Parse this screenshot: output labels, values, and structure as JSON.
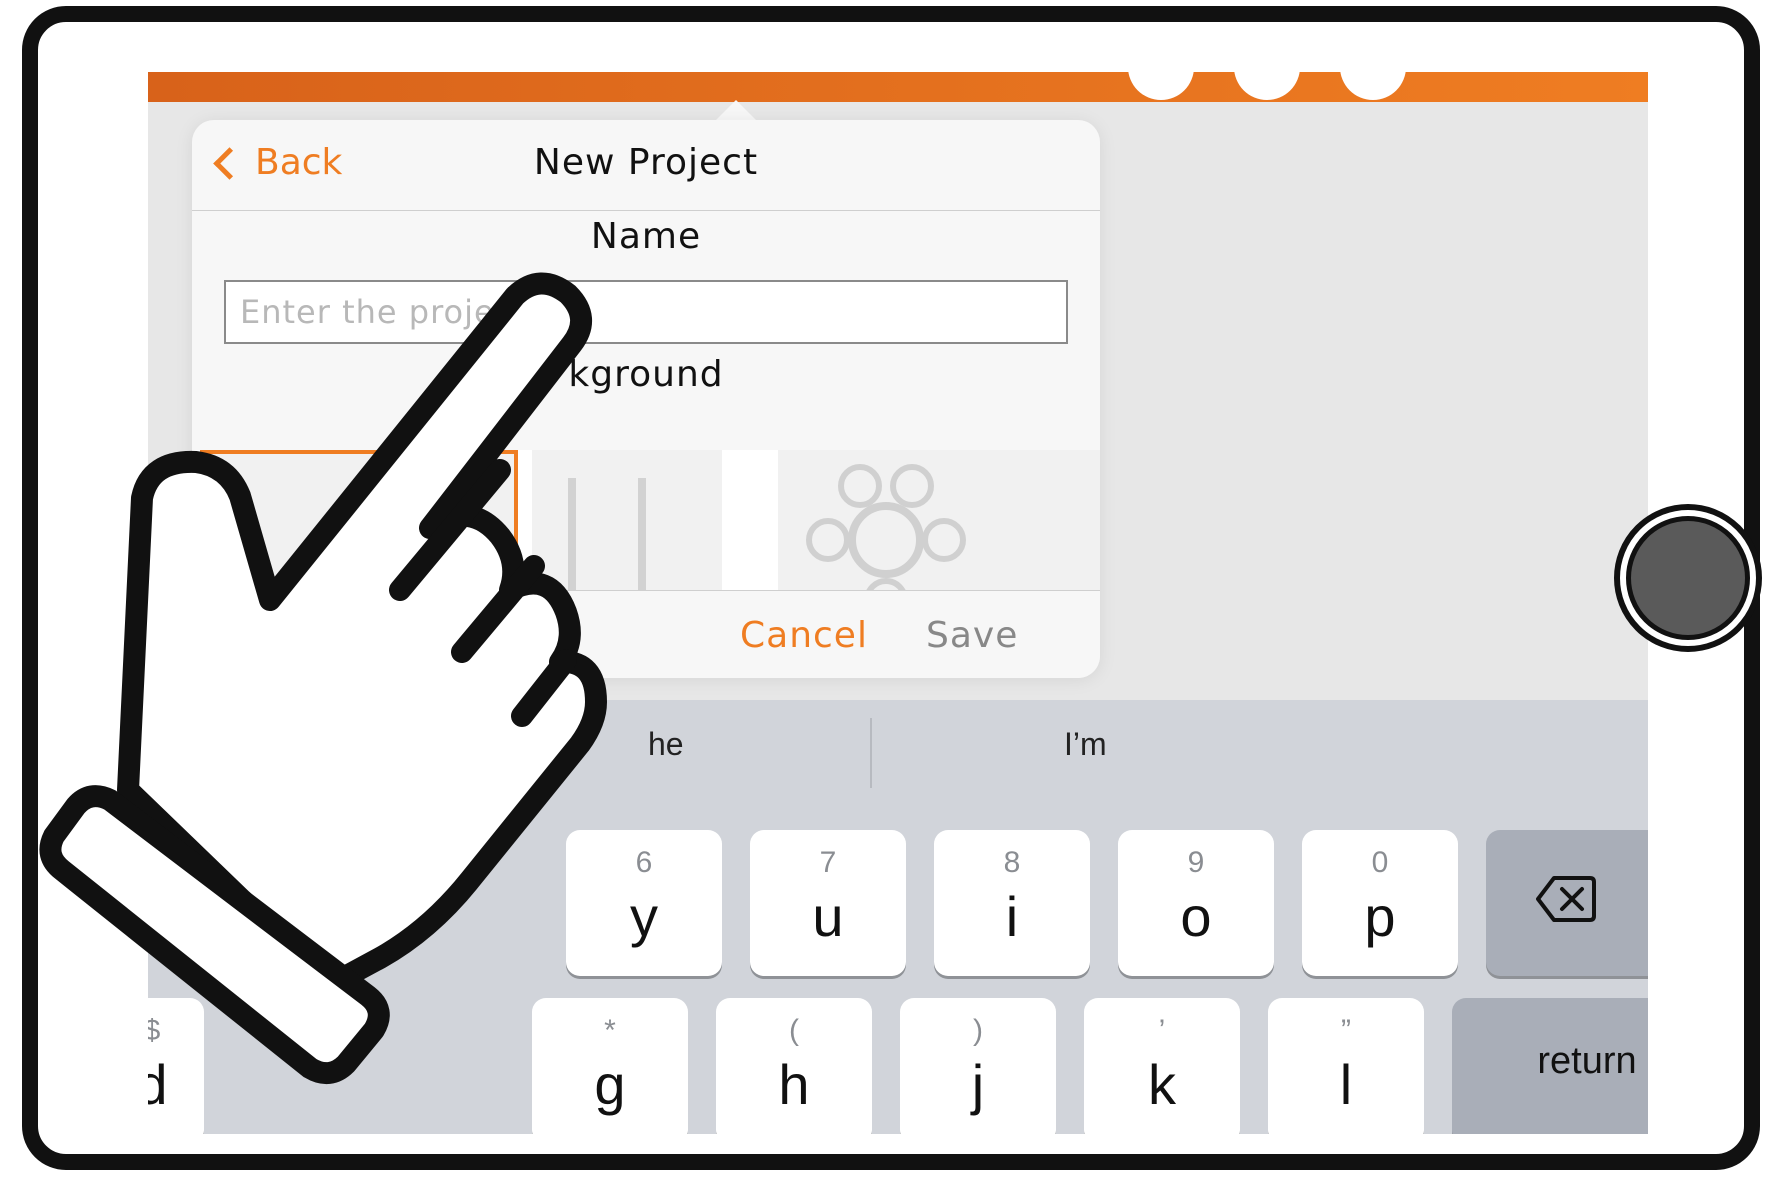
{
  "popover": {
    "back_label": "Back",
    "title": "New Project",
    "name_label": "Name",
    "name_placeholder": "Enter the project",
    "background_label": "Background",
    "background_visible": "kground",
    "cancel_label": "Cancel",
    "save_label": "Save"
  },
  "keyboard": {
    "suggestions": [
      "he",
      "I’m"
    ],
    "row1": [
      {
        "alt": "6",
        "key": "y"
      },
      {
        "alt": "7",
        "key": "u"
      },
      {
        "alt": "8",
        "key": "i"
      },
      {
        "alt": "9",
        "key": "o"
      },
      {
        "alt": "0",
        "key": "p"
      }
    ],
    "row2": [
      {
        "alt": "$",
        "key": "d"
      },
      {
        "alt": "*",
        "key": "g"
      },
      {
        "alt": "(",
        "key": "h"
      },
      {
        "alt": ")",
        "key": "j"
      },
      {
        "alt": "’",
        "key": "k"
      },
      {
        "alt": "”",
        "key": "l"
      }
    ],
    "return_label": "return",
    "delete_icon": "backspace-icon"
  },
  "colors": {
    "accent": "#ef7d22",
    "header_gradient_start": "#d8621a",
    "keyboard_bg": "#d1d4da",
    "frame": "#111111"
  },
  "icons": [
    "back-chevron-icon",
    "backspace-icon",
    "pointing-hand-icon",
    "mindmap-icon"
  ]
}
